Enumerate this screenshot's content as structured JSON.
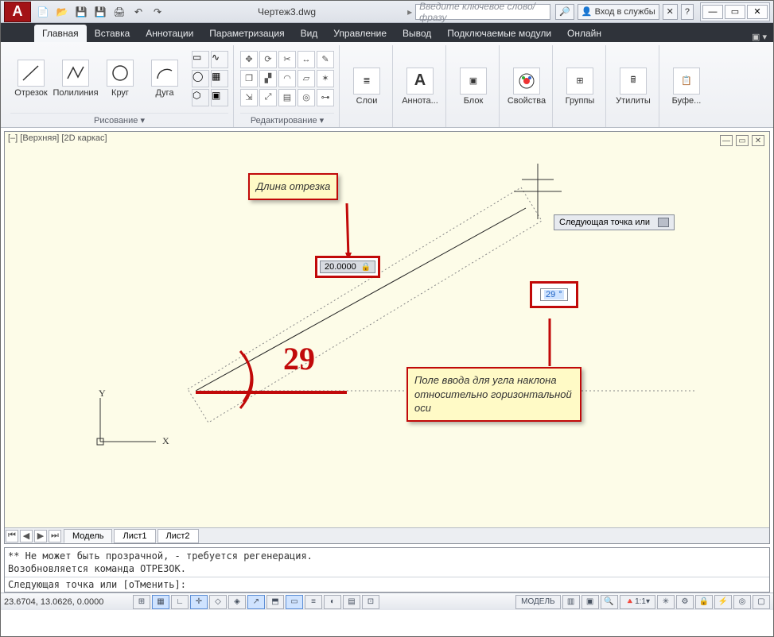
{
  "titlebar": {
    "document": "Чертеж3.dwg",
    "search_placeholder": "Введите ключевое слово/фразу",
    "signin": "Вход в службы"
  },
  "tabs": {
    "items": [
      "Главная",
      "Вставка",
      "Аннотации",
      "Параметризация",
      "Вид",
      "Управление",
      "Вывод",
      "Подключаемые модули",
      "Онлайн"
    ],
    "active_index": 0
  },
  "ribbon": {
    "draw_panel_title": "Рисование ▾",
    "edit_panel_title": "Редактирование ▾",
    "line": "Отрезок",
    "polyline": "Полилиния",
    "circle": "Круг",
    "arc": "Дуга",
    "layers": "Слои",
    "annot": "Аннота...",
    "block": "Блок",
    "props": "Свойства",
    "groups": "Группы",
    "utils": "Утилиты",
    "clip": "Буфе..."
  },
  "canvas": {
    "viewport_label": "[–] [Верхняя] [2D каркас]",
    "length_value": "20.0000",
    "angle_value": "29",
    "angle_degree_suffix": "°",
    "next_point_tooltip": "Следующая точка или",
    "hand_annotation": "29",
    "callout_length": "Длина отрезка",
    "callout_angle": "Поле ввода для угла наклона относительно горизонтальной оси",
    "ucs_y": "Y",
    "ucs_x": "X"
  },
  "model_tabs": {
    "model": "Модель",
    "sheet1": "Лист1",
    "sheet2": "Лист2"
  },
  "cmd": {
    "log_line1": "** Не может быть прозрачной, - требуется регенерация.",
    "log_line2": "Возобновляется команда ОТРЕЗОК.",
    "prompt": "Следующая точка или [оТменить]:"
  },
  "status": {
    "coords": "23.6704, 13.0626, 0.0000",
    "model": "МОДЕЛЬ",
    "scale": "1:1"
  }
}
